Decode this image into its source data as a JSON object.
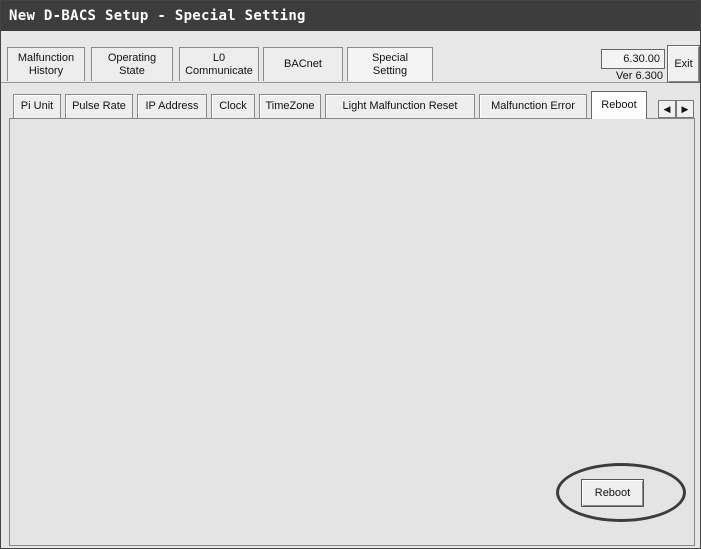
{
  "window": {
    "title": "New D-BACS Setup - Special Setting"
  },
  "main_tabs": [
    {
      "line1": "Malfunction",
      "line2": "History"
    },
    {
      "line1": "Operating",
      "line2": "State"
    },
    {
      "line1": "L0",
      "line2": "Communicate"
    },
    {
      "line1": "BACnet",
      "line2": ""
    },
    {
      "line1": "Special",
      "line2": "Setting"
    }
  ],
  "version": {
    "box": "6.30.00",
    "label": "Ver 6.300"
  },
  "exit_label": "Exit",
  "sub_tabs": [
    {
      "label": "Pi Unit"
    },
    {
      "label": "Pulse Rate"
    },
    {
      "label": "IP Address"
    },
    {
      "label": "Clock"
    },
    {
      "label": "TimeZone"
    },
    {
      "label": "Light Malfunction Reset"
    },
    {
      "label": "Malfunction Error"
    },
    {
      "label": "Reboot"
    }
  ],
  "scroll": {
    "left": "◀",
    "right": "▶"
  },
  "reboot_button_label": "Reboot",
  "colors": {
    "titlebar": "#3d3d3d",
    "panel": "#e4e4e4",
    "highlight": "#3c3c3c"
  }
}
